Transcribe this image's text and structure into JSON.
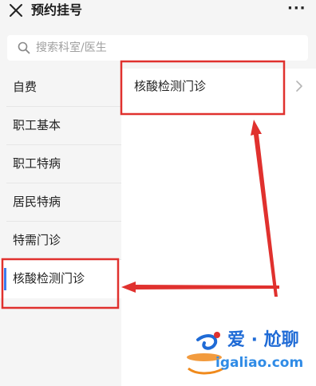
{
  "header": {
    "close_icon": "close-icon",
    "title": "预约挂号",
    "more_label": "···"
  },
  "search": {
    "placeholder": "搜索科室/医生",
    "icon": "search-icon"
  },
  "sidebar": {
    "items": [
      {
        "label": "自费"
      },
      {
        "label": "职工基本"
      },
      {
        "label": "职工特病"
      },
      {
        "label": "居民特病"
      },
      {
        "label": "特需门诊"
      },
      {
        "label": "核酸检测门诊",
        "selected": true
      }
    ],
    "accent_color": "#3d7cf0"
  },
  "content": {
    "entries": [
      {
        "label": "核酸检测门诊",
        "icon": "chevron-right-icon"
      }
    ]
  },
  "annotations": {
    "color": "#e0312e"
  },
  "watermark": {
    "cn_text": "爱 · 尬聊",
    "en_text": "igaliao.com",
    "colors": [
      "#1f6bd6",
      "#f08a1c",
      "#e0312e"
    ]
  }
}
